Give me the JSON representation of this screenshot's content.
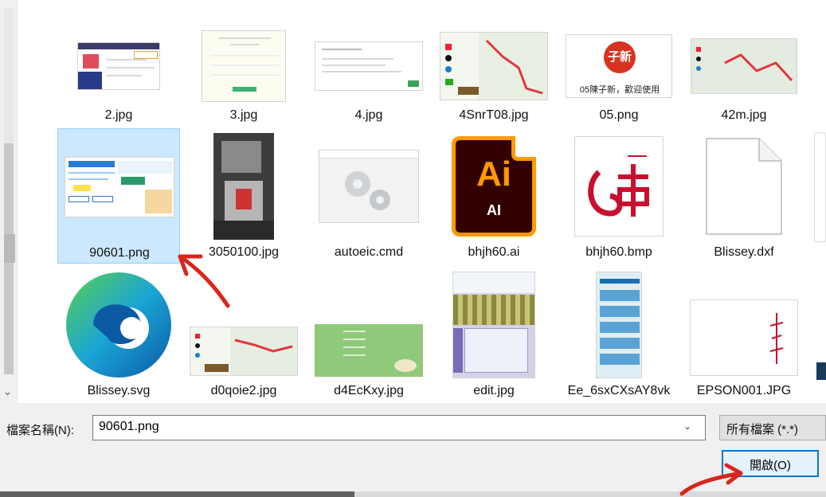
{
  "files": [
    {
      "name": "2.jpg"
    },
    {
      "name": "3.jpg"
    },
    {
      "name": "4.jpg"
    },
    {
      "name": "4SnrT08.jpg"
    },
    {
      "name": "05.png",
      "thumb_text": "05陳子新，歡迎使用",
      "logo_text": "子新"
    },
    {
      "name": "42m.jpg"
    },
    {
      "name": "90601.png",
      "selected": true
    },
    {
      "name": "3050100.jpg"
    },
    {
      "name": "autoeic.cmd"
    },
    {
      "name": "bhjh60.ai",
      "icon_text": "Ai",
      "icon_sub": "AI"
    },
    {
      "name": "bhjh60.bmp"
    },
    {
      "name": "Blissey.dxf"
    },
    {
      "name": "Blissey.svg"
    },
    {
      "name": "d0qoie2.jpg"
    },
    {
      "name": "d4EcKxy.jpg"
    },
    {
      "name": "edit.jpg"
    },
    {
      "name": "Ee_6sxCXsAY8vk"
    },
    {
      "name": "EPSON001.JPG"
    }
  ],
  "footer": {
    "filename_label": "檔案名稱(N):",
    "filename_value": "90601.png",
    "filter_label": "所有檔案 (*.*)",
    "open_label": "開啟(O)"
  },
  "colors": {
    "selection_bg": "#cce8ff",
    "selection_border": "#99d1ff",
    "accent": "#0078d7",
    "annotation": "#d9261c",
    "ai_orange": "#ff9a00",
    "ai_dark": "#330000",
    "edge_blue": "#0c59a4",
    "edge_green": "#5bcf4e"
  },
  "icons": {
    "annotation_arrow": "red-arrow-icon",
    "dropdown": "chevron-down-icon",
    "scroll_down": "scroll-down-icon"
  }
}
